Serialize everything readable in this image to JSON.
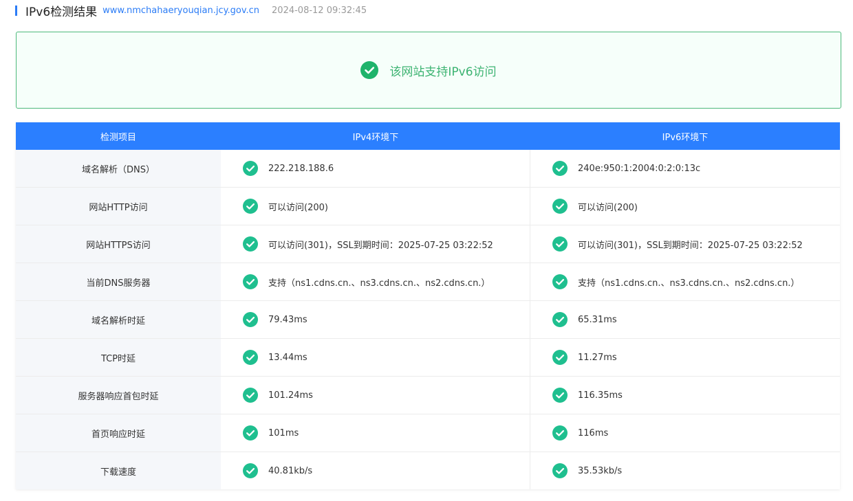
{
  "header": {
    "title": "IPv6检测结果",
    "domain": "www.nmchahaeryouqian.jcy.gov.cn",
    "time": "2024-08-12 09:32:45"
  },
  "result": {
    "icon": "check-circle-icon",
    "text": "该网站支持IPv6访问"
  },
  "colors": {
    "accent": "#2b7fff",
    "success": "#3cb371",
    "check": "#1fbf8f"
  },
  "table": {
    "headers": [
      "检测项目",
      "IPv4环境下",
      "IPv6环境下"
    ],
    "rows": [
      {
        "label": "域名解析（DNS）",
        "ipv4": "222.218.188.6",
        "ipv6": "240e:950:1:2004:0:2:0:13c"
      },
      {
        "label": "网站HTTP访问",
        "ipv4": "可以访问(200)",
        "ipv6": "可以访问(200)"
      },
      {
        "label": "网站HTTPS访问",
        "ipv4": "可以访问(301)，SSL到期时间：2025-07-25 03:22:52",
        "ipv6": "可以访问(301)，SSL到期时间：2025-07-25 03:22:52"
      },
      {
        "label": "当前DNS服务器",
        "ipv4": "支持（ns1.cdns.cn.、ns3.cdns.cn.、ns2.cdns.cn.）",
        "ipv6": "支持（ns1.cdns.cn.、ns3.cdns.cn.、ns2.cdns.cn.）"
      },
      {
        "label": "域名解析时延",
        "ipv4": "79.43ms",
        "ipv6": "65.31ms"
      },
      {
        "label": "TCP时延",
        "ipv4": "13.44ms",
        "ipv6": "11.27ms"
      },
      {
        "label": "服务器响应首包时延",
        "ipv4": "101.24ms",
        "ipv6": "116.35ms"
      },
      {
        "label": "首页响应时延",
        "ipv4": "101ms",
        "ipv6": "116ms"
      },
      {
        "label": "下载速度",
        "ipv4": "40.81kb/s",
        "ipv6": "35.53kb/s"
      }
    ]
  }
}
